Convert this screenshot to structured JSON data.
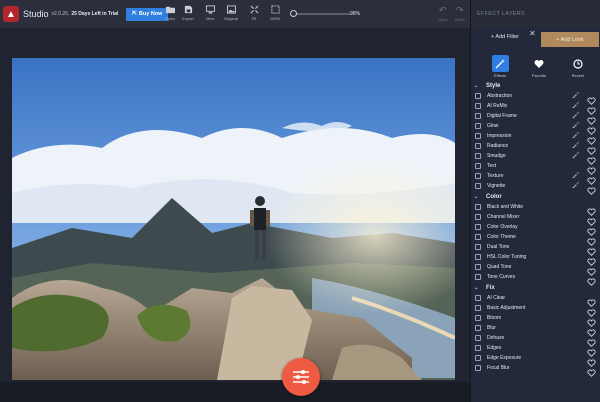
{
  "header": {
    "app_name": "Studio",
    "version": "v2.0.26,",
    "trial": "25 Days Left in Trial",
    "buy_label": "Buy Now",
    "tools": [
      {
        "label": "Open",
        "icon": "folder-icon"
      },
      {
        "label": "Export",
        "icon": "export-icon"
      },
      {
        "label": "View",
        "icon": "monitor-icon"
      },
      {
        "label": "Original",
        "icon": "image-icon"
      },
      {
        "label": "Fit",
        "icon": "fit-icon"
      },
      {
        "label": "100%",
        "icon": "actual-size-icon"
      }
    ],
    "zoom_value": "96%",
    "undo_label": "Undo",
    "redo_label": "Redo"
  },
  "panel": {
    "title": "EFFECT LAYERS",
    "add_filter": "+ Add Filter",
    "add_look": "+ Add Look",
    "tabs": [
      {
        "label": "Effects",
        "icon": "wand-icon",
        "active": true
      },
      {
        "label": "Favorite",
        "icon": "heart-icon"
      },
      {
        "label": "Recent",
        "icon": "clock-icon"
      }
    ],
    "sections": [
      {
        "name": "Style",
        "items": [
          {
            "label": "Abstraction",
            "brush": true
          },
          {
            "label": "AI ReMix",
            "brush": true
          },
          {
            "label": "Digital Frame",
            "brush": true
          },
          {
            "label": "Glow",
            "brush": true
          },
          {
            "label": "Impression",
            "brush": true
          },
          {
            "label": "Radiance",
            "brush": true
          },
          {
            "label": "Smudge",
            "brush": true
          },
          {
            "label": "Text",
            "brush": false
          },
          {
            "label": "Texture",
            "brush": true
          },
          {
            "label": "Vignette",
            "brush": true
          }
        ]
      },
      {
        "name": "Color",
        "items": [
          {
            "label": "Black and White"
          },
          {
            "label": "Channel Mixer"
          },
          {
            "label": "Color Overlay"
          },
          {
            "label": "Color Theme"
          },
          {
            "label": "Dual Tone"
          },
          {
            "label": "HSL Color Tuning"
          },
          {
            "label": "Quad Tone"
          },
          {
            "label": "Tone Curves"
          }
        ]
      },
      {
        "name": "Fix",
        "items": [
          {
            "label": "AI Clear"
          },
          {
            "label": "Basic Adjustment"
          },
          {
            "label": "Bloom"
          },
          {
            "label": "Blur"
          },
          {
            "label": "Dehaze"
          },
          {
            "label": "Edges"
          },
          {
            "label": "Edge Exposure"
          },
          {
            "label": "Focal Blur"
          }
        ]
      }
    ]
  },
  "colors": {
    "accent": "#2f7ee0",
    "adjust_button": "#ef5a42",
    "add_look": "#b08a5c",
    "logo": "#b3262d"
  }
}
